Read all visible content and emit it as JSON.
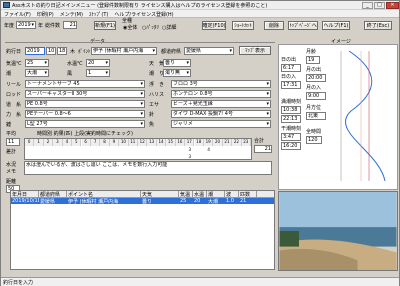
{
  "window": {
    "title": "Ass木ストの釣り日記メインメニュー (登録件数制限有り ライセンス購入はヘルプのライセンス登録を参照のこと)",
    "btn_min": "_",
    "btn_max": "□",
    "btn_close": "✕"
  },
  "menu": [
    "ファイル(F)",
    "印刷(P)",
    "メンテ(M)",
    "ｽﾅｯﾌﾟ(T)",
    "ヘルプ/ライセンス登録(H)"
  ],
  "header": {
    "year_label": "年度",
    "year_value": "2019",
    "year_unit": "年",
    "count_label": "総件数",
    "count_value": "21",
    "btn_new": "新規(F1)",
    "kind_label": "全種",
    "radio_all": "全体",
    "radio_month": "ﾊﾟｯﾀﾘ",
    "radio_detail": "詳細",
    "btn_confirm": "確定(F10)",
    "btn_shortcut": "ｼｮｰﾄｶｯﾄ",
    "btn_delete": "削除",
    "btn_top": "ﾄｯﾌﾟﾍﾟｰｼﾞへ",
    "btn_help": "ヘルプ(F1)",
    "btn_exit": "終了(Esc)"
  },
  "form": {
    "section_data": "データ",
    "section_image": "イメージ",
    "date_label": "釣行日",
    "date_value": "2019",
    "date_value2": "10",
    "date_value3": "18",
    "weekday": "木",
    "point_label": "ﾎﾟｲﾝﾄ",
    "point_value": "伊予 (休暇村 瀬戸内海",
    "pref_label": "都道府県",
    "pref_value": "愛媛県",
    "map_btn": "ﾏｯﾌﾟ表示",
    "temp_label": "気温℃",
    "temp_value": "25",
    "water_label": "水温℃",
    "water_value": "20",
    "weather_label": "天　気",
    "weather_value": "曇り",
    "tide_label": "潮",
    "tide_value": "大潮",
    "wind_label": "風",
    "wind_value": "1",
    "water_cond_label": "潮　り",
    "water_cond_value": "濁り無",
    "reel_label": "リール",
    "reel_value": "トーナメントサーフ 45",
    "float_label": "浮　き",
    "float_value": "フロロ 3号",
    "rod_label": "ロッド",
    "rod_value": "スーパーキャスターⅡ 30号",
    "harris_label": "ハリス",
    "harris_value": "ホンテロン 0.8号",
    "line_label": "道　糸",
    "line_value": "PE 0.8号",
    "bait_label": "エサ",
    "bait_value": "ビーズ＋発光玉縁",
    "shock_label": "力　糸",
    "shock_value": "PEテーパー 0.8～6",
    "hook_label": "針",
    "hook_value": "ダイワ D-MAX 投鋼7! 4号",
    "sinker_label": "錘",
    "sinker_value": "L型 27号",
    "fish_label": "魚",
    "fish_value": "ジャリメ",
    "avg_label": "平均",
    "avg_value": "11",
    "catch_label": "時間別 釣果(匹) 上段(実釣時間にチェック)",
    "hours": [
      "0",
      "1",
      "2",
      "3",
      "4",
      "5",
      "6",
      "7",
      "8",
      "9",
      "10",
      "11",
      "12",
      "13",
      "14",
      "15",
      "16",
      "17",
      "18",
      "19",
      "20",
      "21",
      "22",
      "23"
    ],
    "total_label": "合計",
    "total_value": "21",
    "row2_value": "3",
    "row2_value2": "4",
    "row3_label": "差計",
    "row3_value": "3",
    "water_desc_label": "水況",
    "memo_label": "メモ",
    "memo_text": "水は澄んでいるが、波はさし違い ここは、メモを数行入力可能",
    "dist_label": "距離",
    "dist_value": "50"
  },
  "table": {
    "headers": [
      "年月日",
      "都道府県",
      "ポイント名",
      "天気",
      "気温",
      "水温",
      "潮",
      "波",
      "匹数"
    ],
    "rows": [
      [
        "2019/10/18",
        "愛媛県",
        "伊予 (休暇村 瀬戸内海",
        "曇り",
        "25",
        "20",
        "大潮",
        "1.0",
        "21"
      ]
    ],
    "map_btn": "地図"
  },
  "sun": {
    "title": "日の出",
    "rise": "6:17",
    "set_title": "日の入",
    "set": "17:31",
    "high_title": "満潮時刻",
    "high1": "10:38",
    "high2": "22:13",
    "low_title": "干潮時刻",
    "low1": "3:47",
    "low2": "16:20"
  },
  "moon": {
    "age_title": "月齢",
    "age_value": "19",
    "moonrise_title": "月の出",
    "moonrise": "20:00",
    "moonset_title": "月の入",
    "moonset": "9:00",
    "direction_title": "月方位",
    "direction": "北東",
    "hour_title": "全時間",
    "hour_value": "120"
  },
  "status": {
    "text": "釣行日を入力"
  }
}
